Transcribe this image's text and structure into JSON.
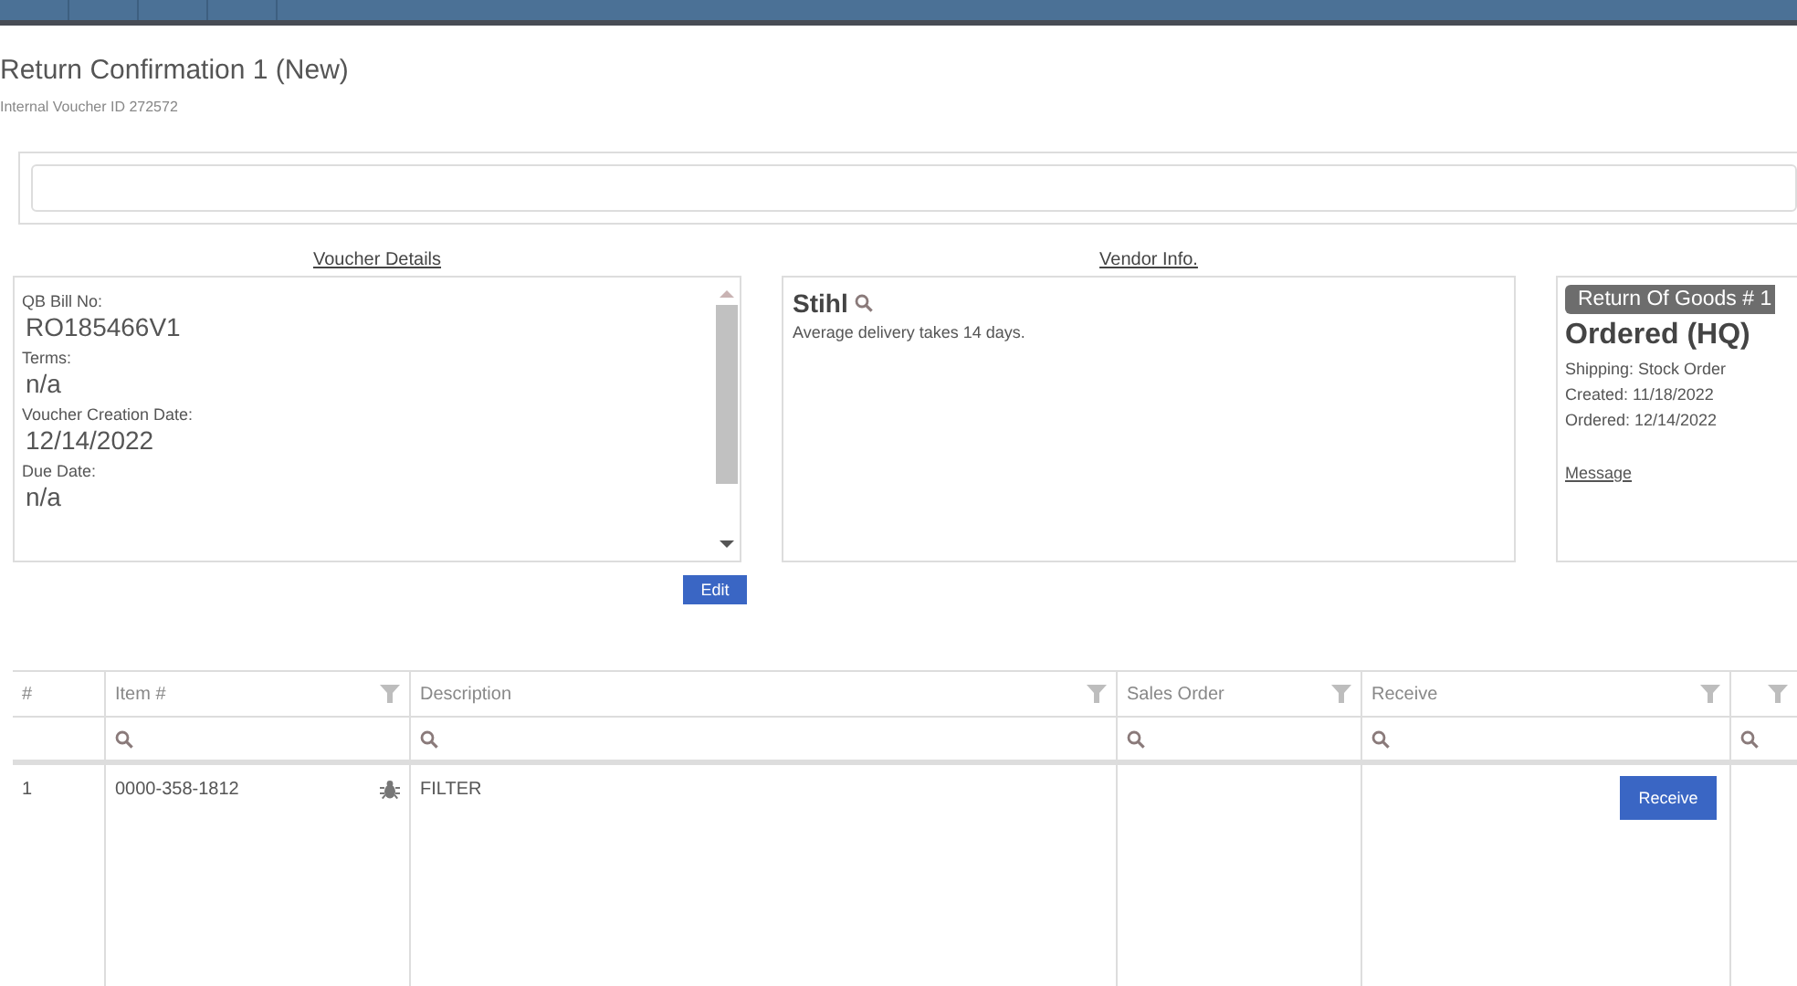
{
  "title": "Return Confirmation 1 (New)",
  "subtitle": "Internal Voucher ID 272572",
  "voucher_details": {
    "heading": "Voucher Details",
    "fields": [
      {
        "label": "QB Bill No:",
        "value": "RO185466V1"
      },
      {
        "label": "Terms:",
        "value": "n/a"
      },
      {
        "label": "Voucher Creation Date:",
        "value": "12/14/2022"
      },
      {
        "label": "Due Date:",
        "value": "n/a"
      }
    ],
    "button": "Edit"
  },
  "vendor_info": {
    "heading": "Vendor Info.",
    "name": "Stihl",
    "note": "Average delivery takes 14 days."
  },
  "order_status": {
    "badge": "Return Of Goods # 1",
    "status": "Ordered (HQ)",
    "lines": [
      "Shipping: Stock Order",
      "Created: 11/18/2022",
      "Ordered: 12/14/2022"
    ],
    "link": "Message"
  },
  "table": {
    "columns": [
      {
        "label": "#",
        "filterable": false,
        "searchable": false
      },
      {
        "label": "Item #",
        "filterable": true,
        "searchable": true
      },
      {
        "label": "Description",
        "filterable": true,
        "searchable": true
      },
      {
        "label": "Sales Order",
        "filterable": true,
        "searchable": true
      },
      {
        "label": "Receive",
        "filterable": true,
        "searchable": true
      },
      {
        "filterable": true,
        "searchable": true
      }
    ],
    "rows": [
      {
        "number": "1",
        "item": "0000-358-1812",
        "description": "FILTER",
        "action": "Receive"
      }
    ]
  }
}
